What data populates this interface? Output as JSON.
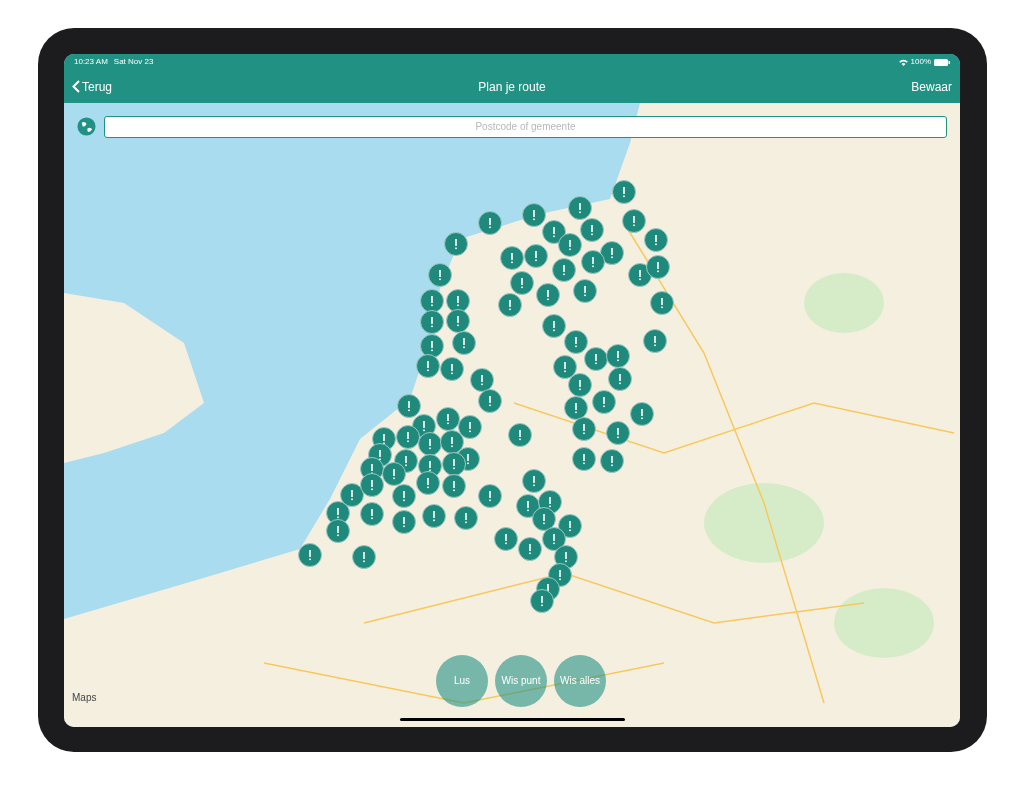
{
  "status_bar": {
    "time": "10:23 AM",
    "date": "Sat Nov 23",
    "battery": "100%"
  },
  "nav_bar": {
    "back": "Terug",
    "title": "Plan je route",
    "action": "Bewaar"
  },
  "search": {
    "placeholder": "Postcode of gemeente"
  },
  "map": {
    "attribution": "Maps"
  },
  "buttons": [
    "Lus",
    "Wis punt",
    "Wis alles"
  ]
}
